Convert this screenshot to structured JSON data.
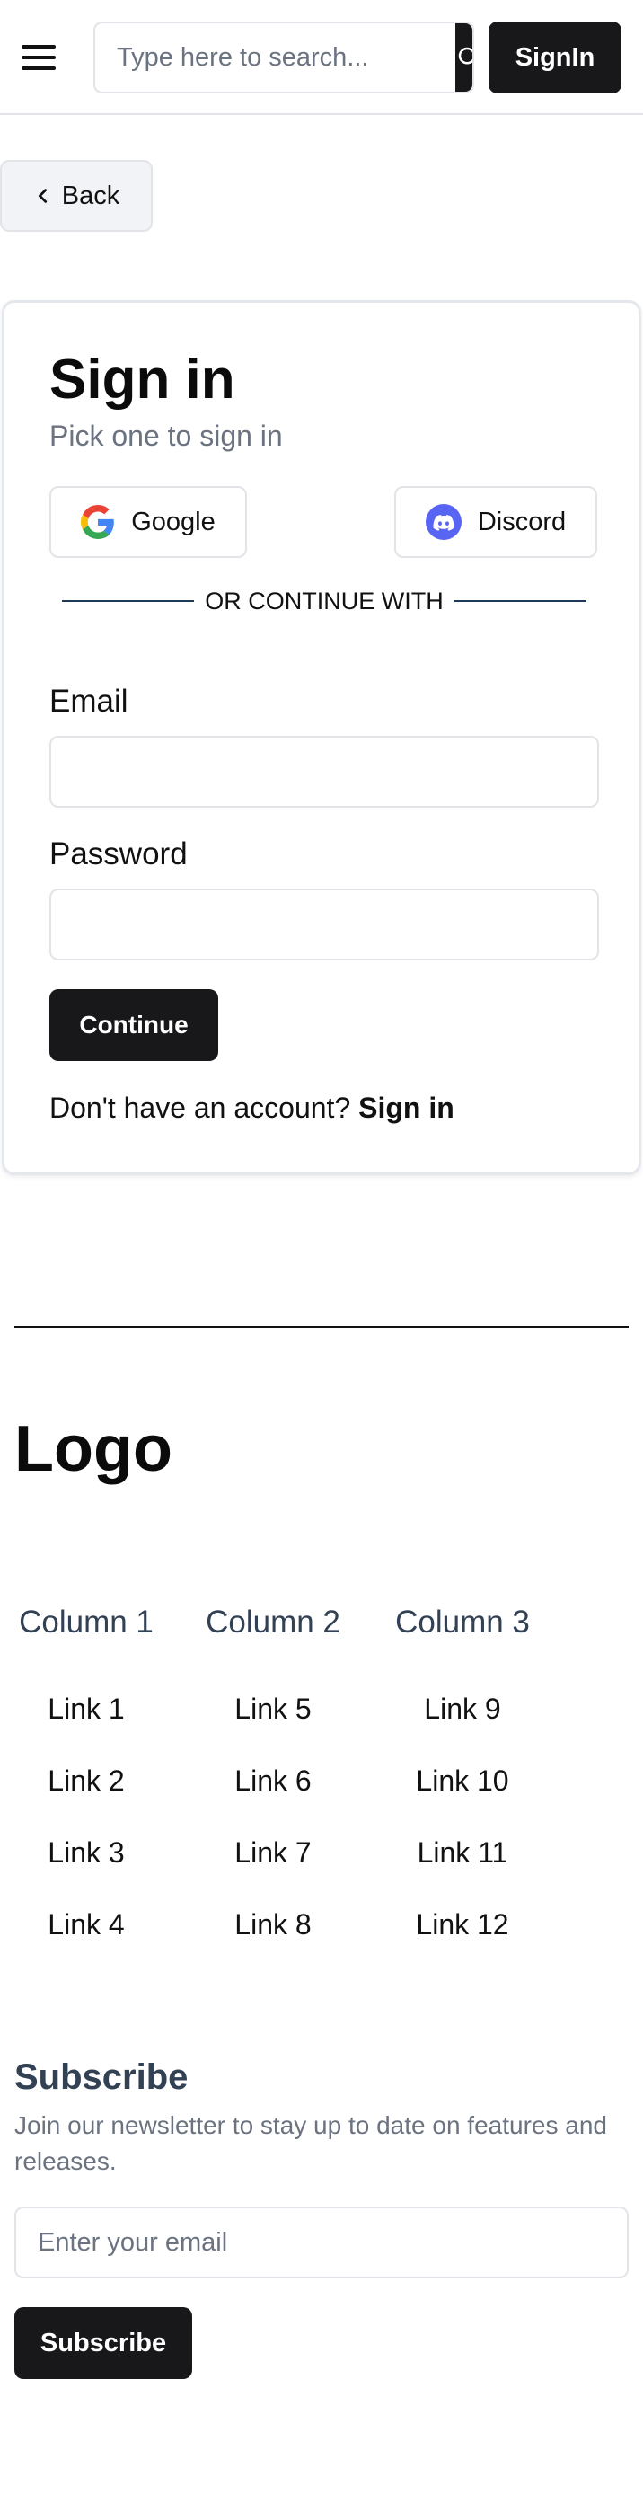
{
  "header": {
    "menu_icon": "hamburger-menu-icon",
    "search": {
      "placeholder": "Type here to search...",
      "value": "",
      "icon": "search-icon"
    },
    "signin_label": "SignIn"
  },
  "back": {
    "label": "Back",
    "icon": "chevron-left-icon"
  },
  "signin_card": {
    "title": "Sign in",
    "subtitle": "Pick one to sign in",
    "oauth": [
      {
        "label": "Google",
        "icon": "google-icon"
      },
      {
        "label": "Discord",
        "icon": "discord-icon"
      }
    ],
    "divider_text": "OR CONTINUE WITH",
    "email_label": "Email",
    "email_value": "",
    "password_label": "Password",
    "password_value": "",
    "continue_label": "Continue",
    "account_prompt": "Don't have an account?",
    "account_link": "Sign in"
  },
  "footer": {
    "logo": "Logo",
    "columns": [
      {
        "title": "Column 1",
        "links": [
          "Link 1",
          "Link 2",
          "Link 3",
          "Link 4"
        ]
      },
      {
        "title": "Column 2",
        "links": [
          "Link 5",
          "Link 6",
          "Link 7",
          "Link 8"
        ]
      },
      {
        "title": "Column 3",
        "links": [
          "Link 9",
          "Link 10",
          "Link 11",
          "Link 12"
        ]
      }
    ],
    "subscribe": {
      "title": "Subscribe",
      "description": "Join our newsletter to stay up to date on features and releases.",
      "placeholder": "Enter your email",
      "button_label": "Subscribe"
    }
  },
  "colors": {
    "primary_button": "#18181b",
    "muted_text": "#6b7280",
    "border": "#e2e4e8",
    "discord": "#5865f2"
  }
}
